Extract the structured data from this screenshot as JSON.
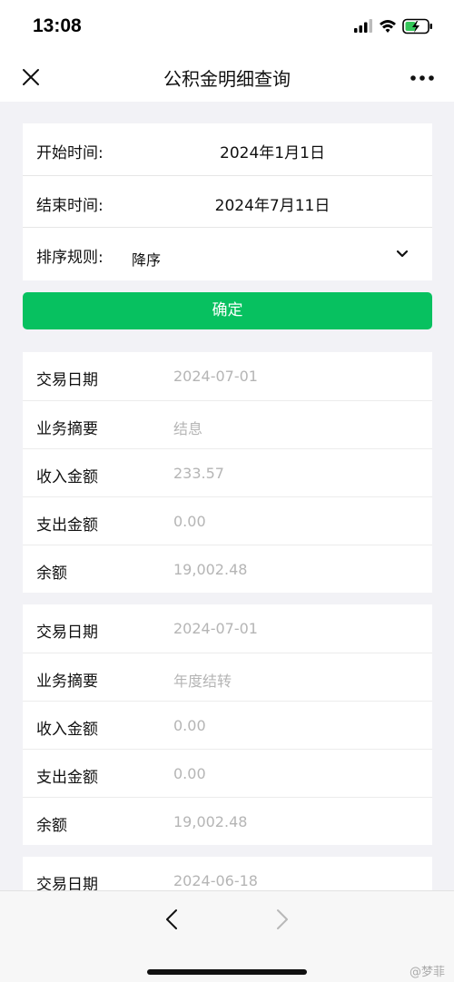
{
  "status_bar": {
    "time": "13:08"
  },
  "nav": {
    "title": "公积金明细查询"
  },
  "form": {
    "start_label": "开始时间:",
    "start_value": "2024年1月1日",
    "end_label": "结束时间:",
    "end_value": "2024年7月11日",
    "sort_label": "排序规则:",
    "sort_value": "降序"
  },
  "confirm_label": "确定",
  "records": [
    {
      "rows": [
        {
          "label": "交易日期",
          "value": "2024-07-01"
        },
        {
          "label": "业务摘要",
          "value": "结息"
        },
        {
          "label": "收入金额",
          "value": "233.57"
        },
        {
          "label": "支出金额",
          "value": "0.00"
        },
        {
          "label": "余额",
          "value": "19,002.48"
        }
      ]
    },
    {
      "rows": [
        {
          "label": "交易日期",
          "value": "2024-07-01"
        },
        {
          "label": "业务摘要",
          "value": "年度结转"
        },
        {
          "label": "收入金额",
          "value": "0.00"
        },
        {
          "label": "支出金额",
          "value": "0.00"
        },
        {
          "label": "余额",
          "value": "19,002.48"
        }
      ]
    },
    {
      "rows": [
        {
          "label": "交易日期",
          "value": "2024-06-18"
        }
      ]
    }
  ],
  "watermark": "@梦菲",
  "colors": {
    "accent": "#07c160",
    "background": "#f2f2f6",
    "muted_value": "#b5b5b5"
  }
}
